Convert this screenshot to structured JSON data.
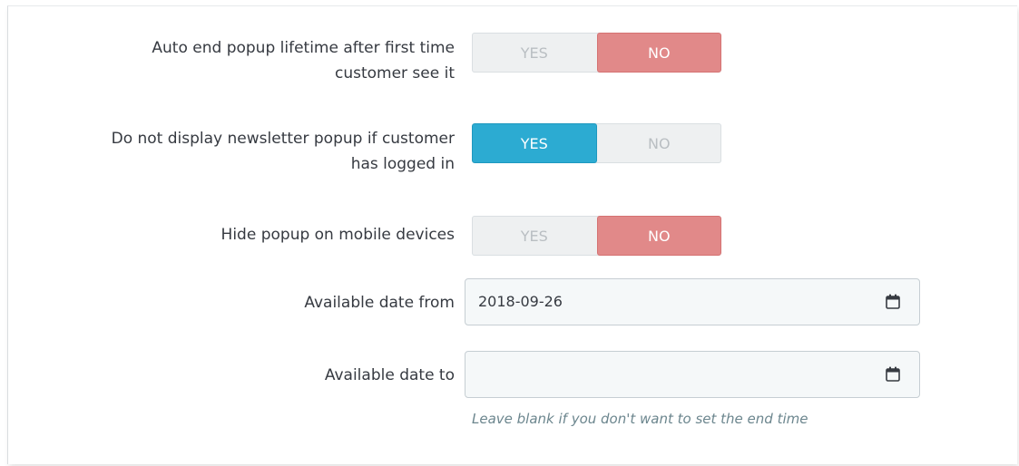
{
  "fields": {
    "auto_end": {
      "label_line1": "Auto end popup lifetime after first time",
      "label_line2": "customer see it",
      "yes": "YES",
      "no": "NO",
      "selected": "NO"
    },
    "hide_logged": {
      "label_line1": "Do not display newsletter popup if customer",
      "label_line2": "has logged in",
      "yes": "YES",
      "no": "NO",
      "selected": "YES"
    },
    "hide_mobile": {
      "label": "Hide popup on mobile devices",
      "yes": "YES",
      "no": "NO",
      "selected": "NO"
    },
    "date_from": {
      "label": "Available date from",
      "value": "2018-09-26",
      "icon": "calendar-icon"
    },
    "date_to": {
      "label": "Available date to",
      "value": "",
      "icon": "calendar-icon",
      "help": "Leave blank if you don't want to set the end time"
    }
  },
  "colors": {
    "no_active": "#e18989",
    "yes_active": "#2cabd2",
    "inactive": "#eef0f1"
  }
}
